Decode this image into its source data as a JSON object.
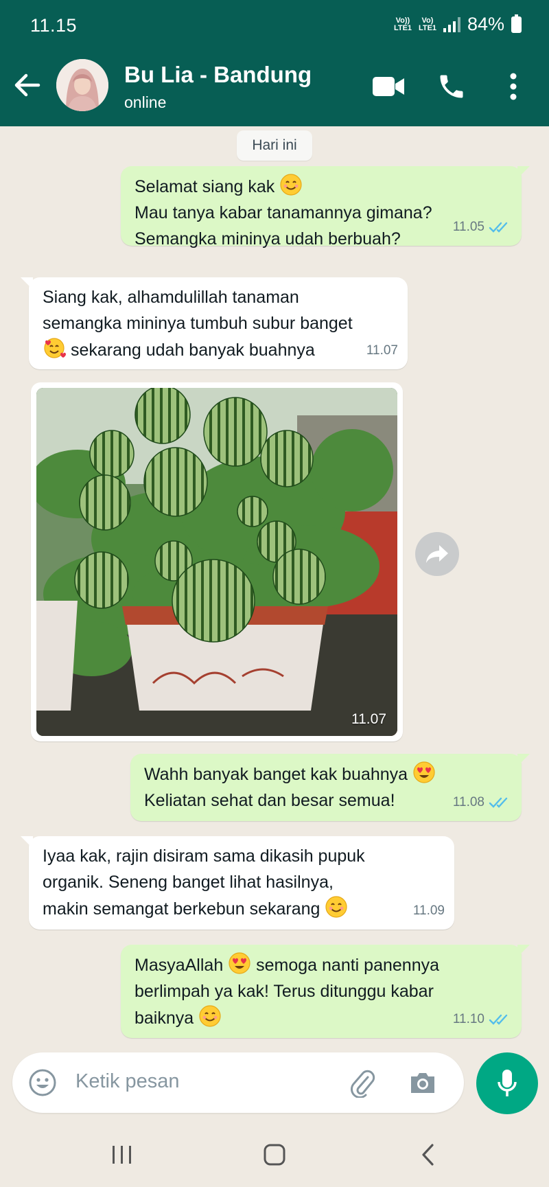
{
  "status_bar": {
    "time": "11.15",
    "network_1": "Vo)) LTE1",
    "network_2": "Vo) LTE1",
    "battery": "84%"
  },
  "header": {
    "contact_name": "Bu Lia - Bandung",
    "status": "online"
  },
  "date_divider": "Hari ini",
  "messages": [
    {
      "direction": "out",
      "lines": [
        "Selamat siang kak",
        "Mau tanya kabar tanamannya gimana?",
        "Semangka mininya udah berbuah?"
      ],
      "time": "11.05",
      "read": true
    },
    {
      "direction": "in",
      "lines": [
        "Siang kak, alhamdulillah tanaman",
        "semangka mininya tumbuh subur banget",
        "sekarang udah banyak buahnya"
      ],
      "time": "11.07"
    },
    {
      "direction": "in",
      "type": "image",
      "image_desc": "watermelon-plant-photo",
      "time": "11.07"
    },
    {
      "direction": "out",
      "lines": [
        "Wahh banyak banget kak buahnya",
        "Keliatan sehat dan besar semua!"
      ],
      "time": "11.08",
      "read": true
    },
    {
      "direction": "in",
      "lines": [
        "Iyaa kak, rajin disiram sama dikasih pupuk",
        "organik. Seneng banget lihat hasilnya,",
        "makin semangat berkebun sekarang"
      ],
      "time": "11.09"
    },
    {
      "direction": "out",
      "lines": [
        "MasyaAllah",
        "semoga nanti panennya",
        "berlimpah ya kak! Terus ditunggu kabar",
        "baiknya"
      ],
      "time": "11.10",
      "read": true
    }
  ],
  "composer": {
    "placeholder": "Ketik pesan"
  },
  "colors": {
    "header": "#075e54",
    "outgoing_bubble": "#dcf8c6",
    "incoming_bubble": "#ffffff",
    "accent": "#00a884",
    "read_tick": "#53bdeb"
  }
}
